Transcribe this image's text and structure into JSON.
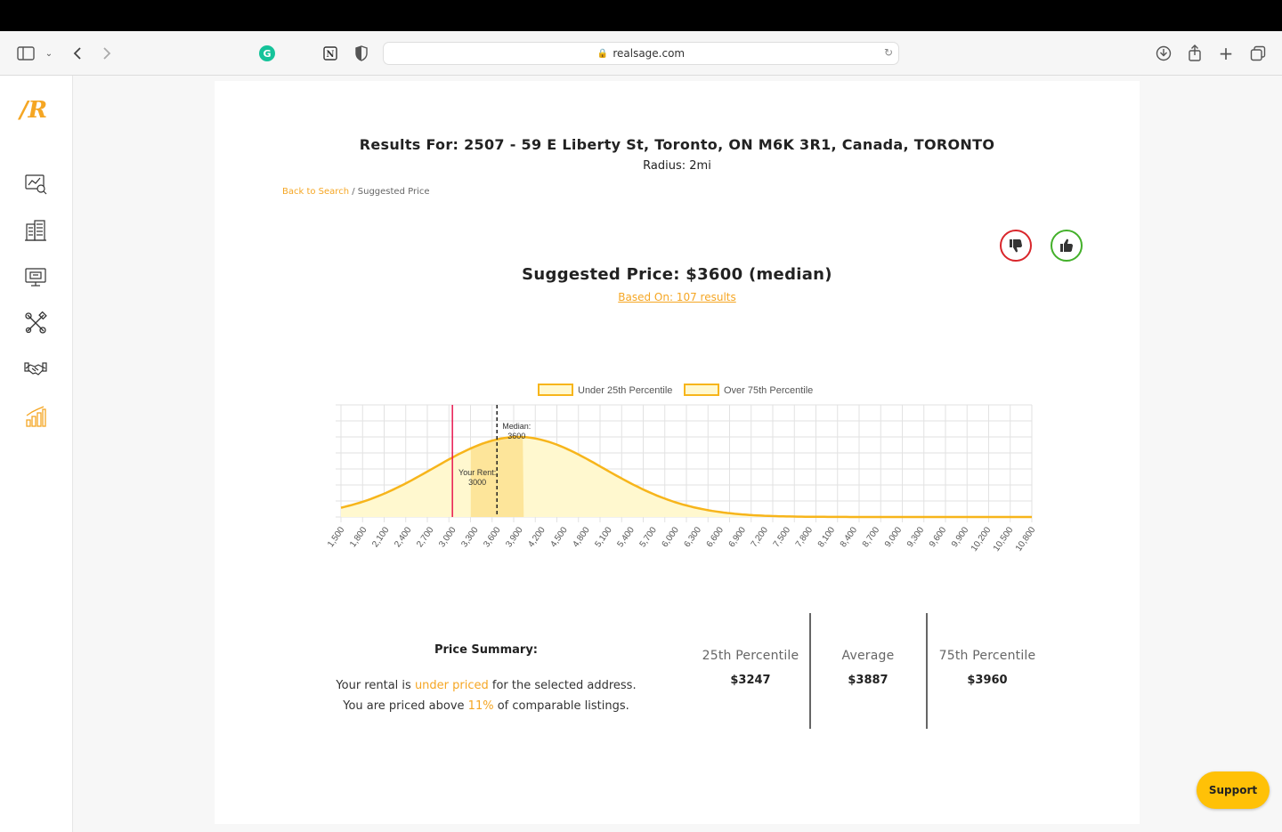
{
  "browser": {
    "url": "realsage.com"
  },
  "sidebar": {
    "logo": "/R",
    "items": [
      {
        "icon": "analytics-icon"
      },
      {
        "icon": "buildings-icon"
      },
      {
        "icon": "monitor-icon"
      },
      {
        "icon": "tools-icon"
      },
      {
        "icon": "handshake-icon"
      },
      {
        "icon": "bar-chart-icon",
        "active": true
      }
    ]
  },
  "header": {
    "title": "Results For: 2507 - 59 E Liberty St, Toronto, ON M6K 3R1, Canada, TORONTO",
    "radius": "Radius: 2mi"
  },
  "breadcrumb": {
    "back": "Back to Search",
    "separator": " / ",
    "current": "Suggested Price"
  },
  "suggested": {
    "price": "Suggested Price: $3600 (median)",
    "based_on": "Based On: 107 results"
  },
  "chart_data": {
    "type": "area",
    "legend": [
      "Under 25th Percentile",
      "Over 75th Percentile"
    ],
    "legend_position": "top",
    "x": [
      1500,
      1800,
      2100,
      2400,
      2700,
      3000,
      3300,
      3600,
      3900,
      4200,
      4500,
      4800,
      5100,
      5400,
      5700,
      6000,
      6300,
      6600,
      6900,
      7200,
      7500,
      7800,
      8100,
      8400,
      8700,
      9000,
      9300,
      9600,
      9900,
      10200,
      10500,
      10800
    ],
    "x_tick_labels": [
      "1,500",
      "1,800",
      "2,100",
      "2,400",
      "2,700",
      "3,000",
      "3,300",
      "3,600",
      "3,900",
      "4,200",
      "4,500",
      "4,800",
      "5,100",
      "5,400",
      "5,700",
      "6,000",
      "6,300",
      "6,600",
      "6,900",
      "7,200",
      "7,500",
      "7,800",
      "8,100",
      "8,400",
      "8,700",
      "9,000",
      "9,300",
      "9,600",
      "9,900",
      "10,200",
      "10,500",
      "10,800"
    ],
    "distribution": {
      "mean": 3887,
      "sd": 1150
    },
    "p25": 3247,
    "p75": 3960,
    "your_rent": 3000,
    "your_rent_label": [
      "Your Rent:",
      "3000"
    ],
    "median": 3600,
    "median_label": [
      "Median:",
      "3600"
    ],
    "grid": true,
    "colors": {
      "line": "#f7b51b",
      "fill": "#fff8cf",
      "band": "#fde59a",
      "your_rent": "#e8174e",
      "median": "#222222"
    }
  },
  "summary": {
    "title": "Price Summary:",
    "line1_pre": "Your rental is ",
    "line1_hl": "under priced",
    "line1_post": " for the selected address.",
    "line2_pre": "You are priced above ",
    "line2_hl": "11%",
    "line2_post": " of comparable listings."
  },
  "stats": [
    {
      "label": "25th Percentile",
      "value": "$3247"
    },
    {
      "label": "Average",
      "value": "$3887"
    },
    {
      "label": "75th Percentile",
      "value": "$3960"
    }
  ],
  "support": "Support"
}
